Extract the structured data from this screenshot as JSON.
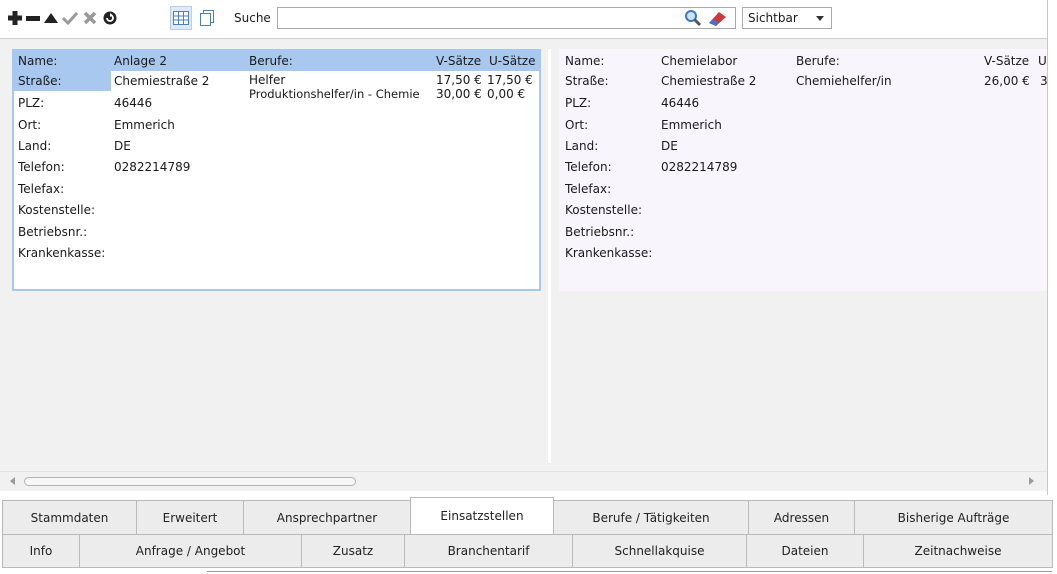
{
  "toolbar": {
    "icons": [
      "add-icon",
      "remove-icon",
      "move-up-icon",
      "confirm-icon",
      "delete-icon",
      "refresh-icon"
    ],
    "view_buttons": [
      "grid-view-icon",
      "card-view-icon"
    ],
    "search_label": "Suche",
    "search_value": "",
    "visibility_selected": "Sichtbar"
  },
  "cards": [
    {
      "name_label": "Name:",
      "name_value": "Anlage 2",
      "strasse_label": "Straße:",
      "strasse_value": "Chemiestraße 2",
      "plz_label": "PLZ:",
      "plz_value": "46446",
      "ort_label": "Ort:",
      "ort_value": "Emmerich",
      "land_label": "Land:",
      "land_value": "DE",
      "telefon_label": "Telefon:",
      "telefon_value": "0282214789",
      "telefax_label": "Telefax:",
      "kostenstelle_label": "Kostenstelle:",
      "betriebsnr_label": "Betriebsnr.:",
      "krankenkasse_label": "Krankenkasse:",
      "berufe_header": "Berufe:",
      "vsaetze_header": "V-Sätze",
      "usaetze_header": "U-Sätze",
      "berufe": [
        {
          "name": "Helfer",
          "v": "17,50 €",
          "u": "17,50 €"
        },
        {
          "name": "Produktionshelfer/in - Chemie",
          "v": "30,00 €",
          "u": "0,00 €"
        }
      ]
    },
    {
      "name_label": "Name:",
      "name_value": "Chemielabor",
      "strasse_label": "Straße:",
      "strasse_value": "Chemiestraße 2",
      "plz_label": "PLZ:",
      "plz_value": "46446",
      "ort_label": "Ort:",
      "ort_value": "Emmerich",
      "land_label": "Land:",
      "land_value": "DE",
      "telefon_label": "Telefon:",
      "telefon_value": "0282214789",
      "telefax_label": "Telefax:",
      "kostenstelle_label": "Kostenstelle:",
      "betriebsnr_label": "Betriebsnr.:",
      "krankenkasse_label": "Krankenkasse:",
      "berufe_header": "Berufe:",
      "vsaetze_header": "V-Sätze",
      "usaetze_header": "U",
      "berufe": [
        {
          "name": "Chemiehelfer/in",
          "v": "26,00 €",
          "u": "3"
        }
      ]
    }
  ],
  "tabs_row1": [
    "Stammdaten",
    "Erweitert",
    "Ansprechpartner",
    "Einsatzstellen",
    "Berufe / Tätigkeiten",
    "Adressen",
    "Bisherige Aufträge"
  ],
  "tabs_row2": [
    "Info",
    "Anfrage / Angebot",
    "Zusatz",
    "Branchentarif",
    "Schnellakquise",
    "Dateien",
    "Zeitnachweise"
  ],
  "active_tab": "Einsatzstellen",
  "colors": {
    "selection": "#a9c8ef",
    "panel": "#f1f1f1",
    "card2_bg": "#f8f5fd"
  }
}
